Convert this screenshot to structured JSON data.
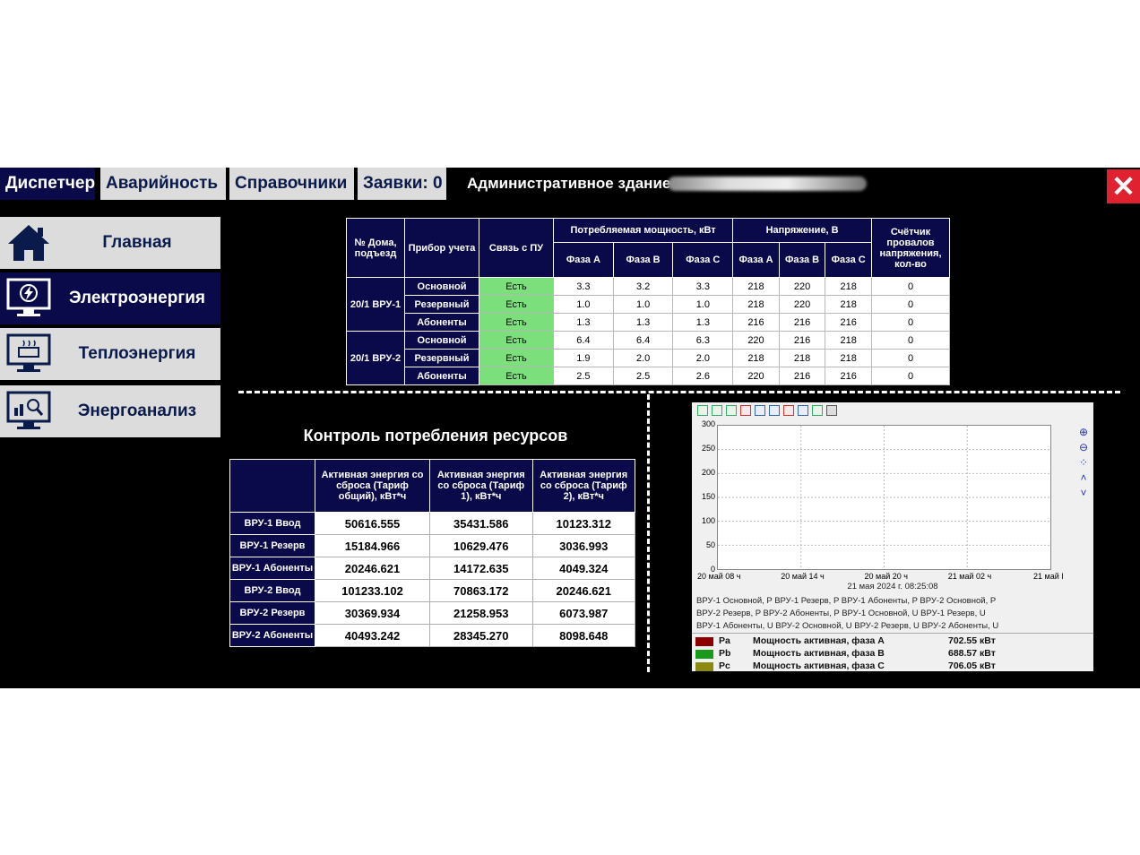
{
  "tabs": [
    {
      "label": "Диспетчер"
    },
    {
      "label": "Аварийность"
    },
    {
      "label": "Справочники"
    },
    {
      "label": "Заявки: 0"
    }
  ],
  "header": {
    "title": "Административное здание"
  },
  "close_label": "✕",
  "sidebar": {
    "items": [
      {
        "label": "Главная",
        "icon": "home-icon"
      },
      {
        "label": "Электроэнергия",
        "icon": "electricity-monitor-icon"
      },
      {
        "label": "Теплоэнергия",
        "icon": "heat-monitor-icon"
      },
      {
        "label": "Энергоанализ",
        "icon": "analysis-monitor-icon"
      }
    ]
  },
  "devices_table": {
    "headers": {
      "house": "№ Дома, подъезд",
      "device": "Прибор учета",
      "link": "Связь с ПУ",
      "power": "Потребляемая мощность, кВт",
      "voltage": "Напряжение, В",
      "counter": "Счётчик провалов напряжения, кол-во",
      "phase_a": "Фаза А",
      "phase_b": "Фаза В",
      "phase_c": "Фаза С"
    },
    "groups": [
      {
        "name": "20/1 ВРУ-1",
        "rows": [
          {
            "device": "Основной",
            "link": "Есть",
            "pa": "3.3",
            "pb": "3.2",
            "pc": "3.3",
            "ua": "218",
            "ub": "220",
            "uc": "218",
            "cnt": "0"
          },
          {
            "device": "Резервный",
            "link": "Есть",
            "pa": "1.0",
            "pb": "1.0",
            "pc": "1.0",
            "ua": "218",
            "ub": "220",
            "uc": "218",
            "cnt": "0"
          },
          {
            "device": "Абоненты",
            "link": "Есть",
            "pa": "1.3",
            "pb": "1.3",
            "pc": "1.3",
            "ua": "216",
            "ub": "216",
            "uc": "216",
            "cnt": "0"
          }
        ]
      },
      {
        "name": "20/1 ВРУ-2",
        "rows": [
          {
            "device": "Основной",
            "link": "Есть",
            "pa": "6.4",
            "pb": "6.4",
            "pc": "6.3",
            "ua": "220",
            "ub": "216",
            "uc": "218",
            "cnt": "0"
          },
          {
            "device": "Резервный",
            "link": "Есть",
            "pa": "1.9",
            "pb": "2.0",
            "pc": "2.0",
            "ua": "218",
            "ub": "218",
            "uc": "218",
            "cnt": "0"
          },
          {
            "device": "Абоненты",
            "link": "Есть",
            "pa": "2.5",
            "pb": "2.5",
            "pc": "2.6",
            "ua": "220",
            "ub": "216",
            "uc": "216",
            "cnt": "0"
          }
        ]
      }
    ]
  },
  "control": {
    "title": "Контроль потребления ресурсов",
    "headers": [
      "Активная энергия со сброса (Тариф общий), кВт*ч",
      "Активная энергия со сброса (Тариф 1), кВт*ч",
      "Активная энергия со сброса (Тариф 2), кВт*ч"
    ],
    "rows": [
      {
        "label": "ВРУ-1 Ввод",
        "v": [
          "50616.555",
          "35431.586",
          "10123.312"
        ]
      },
      {
        "label": "ВРУ-1 Резерв",
        "v": [
          "15184.966",
          "10629.476",
          "3036.993"
        ]
      },
      {
        "label": "ВРУ-1 Абоненты",
        "v": [
          "20246.621",
          "14172.635",
          "4049.324"
        ]
      },
      {
        "label": "ВРУ-2 Ввод",
        "v": [
          "101233.102",
          "70863.172",
          "20246.621"
        ]
      },
      {
        "label": "ВРУ-2 Резерв",
        "v": [
          "30369.934",
          "21258.953",
          "6073.987"
        ]
      },
      {
        "label": "ВРУ-2 Абоненты",
        "v": [
          "40493.242",
          "28345.270",
          "8098.648"
        ]
      }
    ]
  },
  "chart_data": {
    "type": "line",
    "ylim": [
      0,
      300
    ],
    "yticks": [
      "300",
      "250",
      "200",
      "150",
      "100",
      "50",
      "0"
    ],
    "xticks": [
      "20 май 08 ч",
      "20 май 14 ч",
      "20 май 20 ч",
      "21 май 02 ч",
      "21 май I"
    ],
    "timestamp": "21 мая 2024 г. 08:25:08",
    "legend_lines": [
      "ВРУ-1 Основной, P   ВРУ-1 Резерв, P   ВРУ-1 Абоненты, P   ВРУ-2 Основной, P",
      "ВРУ-2 Резерв, P   ВРУ-2 Абоненты, P   ВРУ-1 Основной, U   ВРУ-1 Резерв, U",
      "ВРУ-1 Абоненты, U   ВРУ-2 Основной, U   ВРУ-2 Резерв, U   ВРУ-2 Абоненты, U"
    ],
    "series": [
      {
        "code": "Pa",
        "name": "Мощность активная, фаза А",
        "value": "702.55 кВт",
        "color": "#8b0000"
      },
      {
        "code": "Pb",
        "name": "Мощность активная, фаза В",
        "value": "688.57 кВт",
        "color": "#1a9a1a"
      },
      {
        "code": "Pc",
        "name": "Мощность активная, фаза С",
        "value": "706.05 кВт",
        "color": "#8a8a10"
      }
    ]
  }
}
